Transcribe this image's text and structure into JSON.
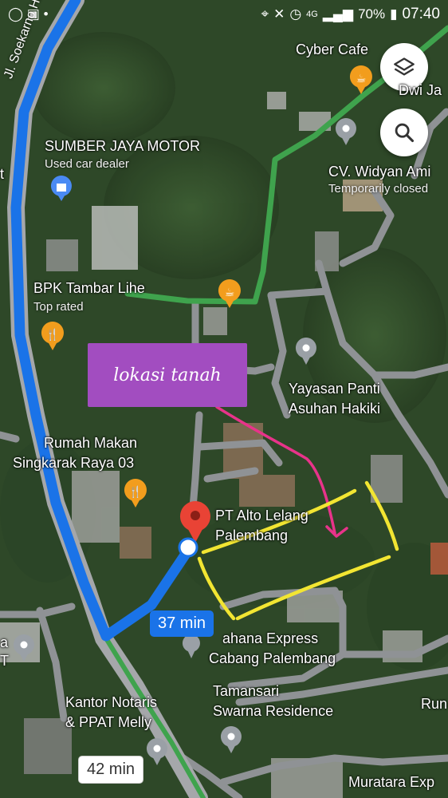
{
  "status_bar": {
    "battery": "70%",
    "time": "07:40",
    "network": "4G"
  },
  "controls": {
    "layers_icon": "layers-icon",
    "search_icon": "search-icon"
  },
  "annotation": {
    "text": "lokasi tanah"
  },
  "places": {
    "cyber_cafe": "Cyber Cafe",
    "dwi": "Dwi Ja",
    "sumber_jaya": "SUMBER JAYA MOTOR",
    "sumber_jaya_sub": "Used car dealer",
    "widyan": "CV. Widyan Ami",
    "widyan_sub": "Temporarily closed",
    "bpk": "BPK Tambar Lihe",
    "bpk_sub": "Top rated",
    "yayasan_1": "Yayasan Panti",
    "yayasan_2": "Asuhan Hakiki",
    "rumah_1": "Rumah Makan",
    "rumah_2": "Singkarak Raya 03",
    "alto_1": "PT Alto Lelang",
    "alto_2": "Palembang",
    "express_1": "ahana Express",
    "express_2": "Cabang Palembang",
    "tamansari_1": "Tamansari",
    "tamansari_2": "Swarna Residence",
    "notaris_1": "Kantor Notaris",
    "notaris_2": "& PPAT Melly",
    "run": "Run",
    "muratara": "Muratara Exp",
    "edge_left_1": "a",
    "edge_left_2": "T",
    "edge_t": "t"
  },
  "road_name": "Jl. Soekarno Hatta",
  "routes": {
    "eta_blue": "37 min",
    "eta_white": "42 min"
  },
  "colors": {
    "route_blue": "#1a73e8",
    "route_green": "#3fa34d",
    "annotation_purple": "#a24dc0",
    "marker_yellow": "#f2e532",
    "arrow_pink": "#e8338a",
    "pin_red": "#e94335"
  }
}
